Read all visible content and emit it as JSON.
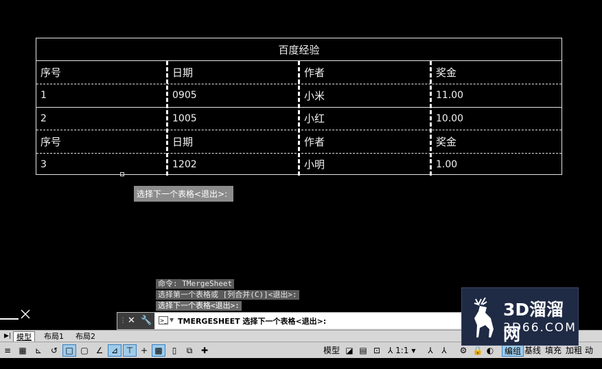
{
  "table": {
    "title": "百度经验",
    "rows": [
      [
        "序号",
        "日期",
        "作者",
        "奖金"
      ],
      [
        "1",
        "0905",
        "小米",
        "11.00"
      ],
      [
        "2",
        "1005",
        "小红",
        "10.00"
      ],
      [
        "序号",
        "日期",
        "作者",
        "奖金"
      ],
      [
        "3",
        "1202",
        "小明",
        "1.00"
      ]
    ]
  },
  "tooltip": "选择下一个表格<退出>:",
  "history": [
    "命令: TMergeSheet",
    "选择第一个表格或 [列合并(C)]<退出>:",
    "选择下一个表格<退出>:"
  ],
  "command_line": "TMERGESHEET 选择下一个表格<退出>:",
  "tabs": [
    "模型",
    "布局1",
    "布局2"
  ],
  "status": {
    "model_label": "模型",
    "scale": "1:1",
    "buttons": [
      "编组",
      "基线",
      "填充",
      "加粗",
      "动态"
    ]
  },
  "watermark": {
    "title": "3D溜溜网",
    "domain": "3D66.COM"
  },
  "colors": {
    "background": "#000000",
    "status_active": "#9ecbea",
    "watermark_bg": "#1f2a44"
  }
}
